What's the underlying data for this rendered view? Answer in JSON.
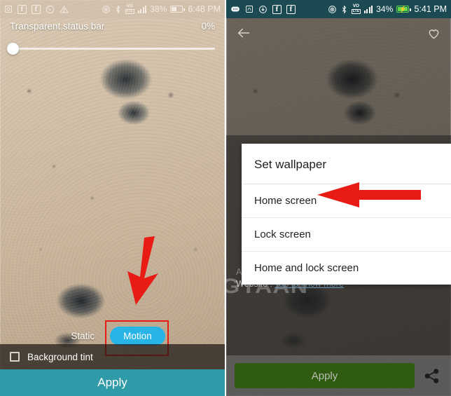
{
  "left_phone": {
    "status_bar": {
      "icons": [
        "screenshot-icon",
        "facebook-icon",
        "facebook-icon",
        "whatsapp-icon",
        "warning-icon",
        "cast-icon",
        "bluetooth-icon",
        "volte-icon",
        "signal-icon"
      ],
      "volte_primary": "VO",
      "volte_secondary": "LTE",
      "battery_percent": "38%",
      "time": "6:48 PM",
      "background_color": "#cdbeac"
    },
    "transparency": {
      "label": "Transparent status bar",
      "value": "0%",
      "slider_position_percent": 0
    },
    "mode_toggle": {
      "static_label": "Static",
      "motion_label": "Motion",
      "selected": "Motion",
      "active_color": "#29b4e8",
      "highlight_color": "#e81c14"
    },
    "background_tint": {
      "label": "Background tint",
      "checked": false
    },
    "apply_button": {
      "label": "Apply",
      "color": "#2f9aa8"
    }
  },
  "right_phone": {
    "status_bar": {
      "icons": [
        "message-icon",
        "network-icon",
        "download-icon",
        "facebook-icon",
        "facebook-icon",
        "cast-icon",
        "bluetooth-icon",
        "volte-icon",
        "signal-icon"
      ],
      "volte_primary": "VO",
      "volte_secondary": "LTE",
      "battery_percent": "34%",
      "battery_charging": true,
      "time": "5:41 PM",
      "background_color": "#1b4a53"
    },
    "top_actions": {
      "back_icon": "back-arrow-icon",
      "favorite_icon": "heart-icon"
    },
    "background_text": {
      "ghost_line": "Author info",
      "website_prefix": "Website :",
      "website_link": "Tap to know more",
      "watermark": "DIGYAAN"
    },
    "dialog": {
      "title": "Set wallpaper",
      "options": [
        {
          "label": "Home screen"
        },
        {
          "label": "Lock screen"
        },
        {
          "label": "Home and lock screen"
        }
      ],
      "highlighted_option": "Home screen",
      "arrow_color": "#e81c14"
    },
    "apply_button": {
      "label": "Apply",
      "color": "#2f5c10"
    },
    "share_icon": "share-icon"
  }
}
